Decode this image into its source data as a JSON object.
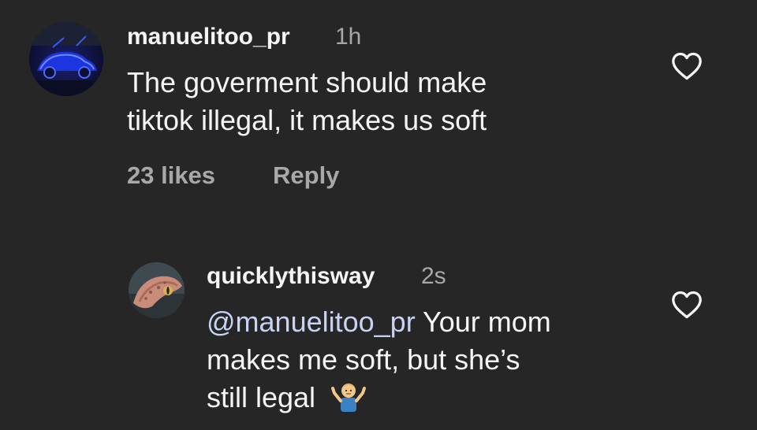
{
  "comments": [
    {
      "username": "manuelitoo_pr",
      "time": "1h",
      "text_line1": "The goverment should make",
      "text_line2": "tiktok illegal, it makes us soft",
      "likes": "23 likes",
      "reply_label": "Reply",
      "avatar_icon": "blue-light-car-avatar",
      "like_icon": "heart-outline-icon"
    },
    {
      "username": "quicklythisway",
      "time": "2s",
      "mention": "@manuelitoo_pr",
      "text_part1": " Your mom",
      "text_line2": "makes me soft, but she’s",
      "text_line3": "still legal",
      "emoji_icon": "man-shrugging-emoji",
      "avatar_icon": "gecko-avatar",
      "like_icon": "heart-outline-icon"
    }
  ],
  "colors": {
    "background": "#262626",
    "primary_text": "#f5f5f5",
    "secondary_text": "#a8a8a8",
    "mention": "#c7d3f5"
  }
}
